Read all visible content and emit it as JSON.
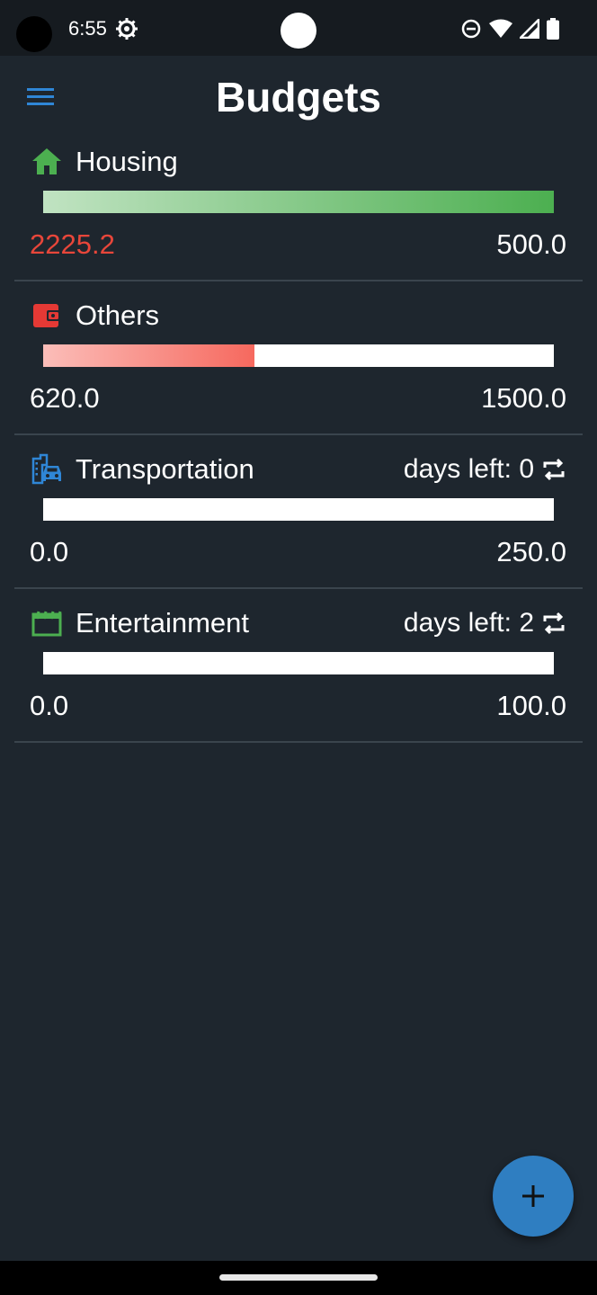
{
  "status_bar": {
    "time": "6:55",
    "icons": [
      "settings-gear-icon",
      "do-not-disturb-icon",
      "wifi-icon",
      "signal-icon",
      "battery-icon"
    ]
  },
  "header": {
    "title": "Budgets",
    "menu_icon": "hamburger-menu-icon"
  },
  "budgets": [
    {
      "name": "Housing",
      "icon": "home-icon",
      "icon_color": "#4caf50",
      "spent": "2225.2",
      "spent_color": "#e8463a",
      "limit": "500.0",
      "progress": 1.0,
      "bar_color": "#4caf50",
      "days_left": null
    },
    {
      "name": "Others",
      "icon": "wallet-icon",
      "icon_color": "#e53935",
      "spent": "620.0",
      "spent_color": "#ffffff",
      "limit": "1500.0",
      "progress": 0.413,
      "bar_color": "#f44336",
      "days_left": null
    },
    {
      "name": "Transportation",
      "icon": "city-car-icon",
      "icon_color": "#2f86d6",
      "spent": "0.0",
      "spent_color": "#ffffff",
      "limit": "250.0",
      "progress": 0,
      "bar_color": "#ffffff",
      "days_left": "days left: 0"
    },
    {
      "name": "Entertainment",
      "icon": "movie-clapper-icon",
      "icon_color": "#4caf50",
      "spent": "0.0",
      "spent_color": "#ffffff",
      "limit": "100.0",
      "progress": 0,
      "bar_color": "#ffffff",
      "days_left": "days left: 2"
    }
  ],
  "fab": {
    "icon": "plus-icon",
    "color": "#2f7ec1"
  }
}
